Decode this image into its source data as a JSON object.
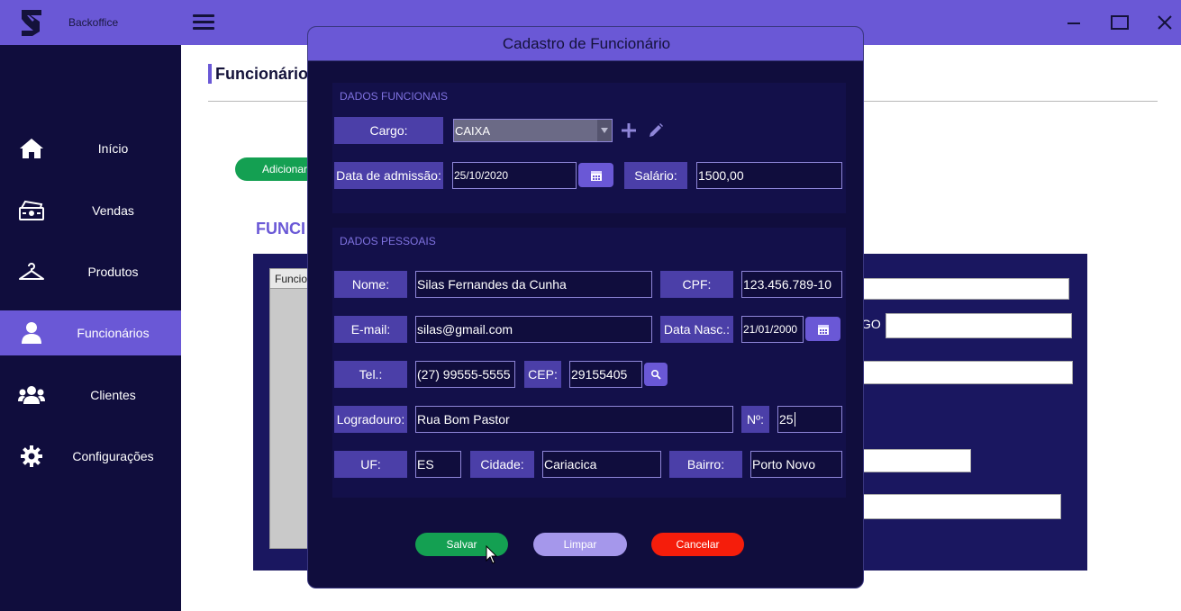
{
  "app": {
    "title": "Backoffice"
  },
  "window_controls": [
    "minimize-icon",
    "maximize-icon",
    "close-icon"
  ],
  "sidebar": {
    "items": [
      {
        "label": "Início",
        "icon": "home-icon",
        "active": false
      },
      {
        "label": "Vendas",
        "icon": "cash-register-icon",
        "active": false
      },
      {
        "label": "Produtos",
        "icon": "hanger-icon",
        "active": false
      },
      {
        "label": "Funcionários",
        "icon": "user-icon",
        "active": true
      },
      {
        "label": "Clientes",
        "icon": "users-icon",
        "active": false
      },
      {
        "label": "Configurações",
        "icon": "gear-icon",
        "active": false
      }
    ]
  },
  "background_page": {
    "title": "Funcionário",
    "add_button": "Adicionar",
    "section_heading": "FUNCI",
    "table_header": "Funcio",
    "partial_label": "GO"
  },
  "modal": {
    "title": "Cadastro de Funcionário",
    "functional": {
      "heading": "DADOS FUNCIONAIS",
      "cargo_label": "Cargo:",
      "cargo_value": "CAIXA",
      "admissao_label": "Data de admissão:",
      "admissao_value": "25/10/2020",
      "salario_label": "Salário:",
      "salario_value": "1500,00"
    },
    "personal": {
      "heading": "DADOS PESSOAIS",
      "nome_label": "Nome:",
      "nome_value": "Silas Fernandes da Cunha",
      "cpf_label": "CPF:",
      "cpf_value": "123.456.789-10",
      "email_label": "E-mail:",
      "email_value": "silas@gmail.com",
      "nasc_label": "Data Nasc.:",
      "nasc_value": "21/01/2000",
      "tel_label": "Tel.:",
      "tel_value": "(27) 99555-5555",
      "cep_label": "CEP:",
      "cep_value": "29155405",
      "logradouro_label": "Logradouro:",
      "logradouro_value": "Rua Bom Pastor",
      "numero_label": "Nº:",
      "numero_value": "25",
      "uf_label": "UF:",
      "uf_value": "ES",
      "cidade_label": "Cidade:",
      "cidade_value": "Cariacica",
      "bairro_label": "Bairro:",
      "bairro_value": "Porto Novo"
    },
    "buttons": {
      "save": "Salvar",
      "clear": "Limpar",
      "cancel": "Cancelar"
    }
  },
  "colors": {
    "accent": "#6a58d6",
    "sidebar_bg": "#100d3d",
    "label_bg": "#4b3fa8",
    "save": "#14a052",
    "clear": "#a597eb",
    "cancel": "#f51d0b"
  }
}
